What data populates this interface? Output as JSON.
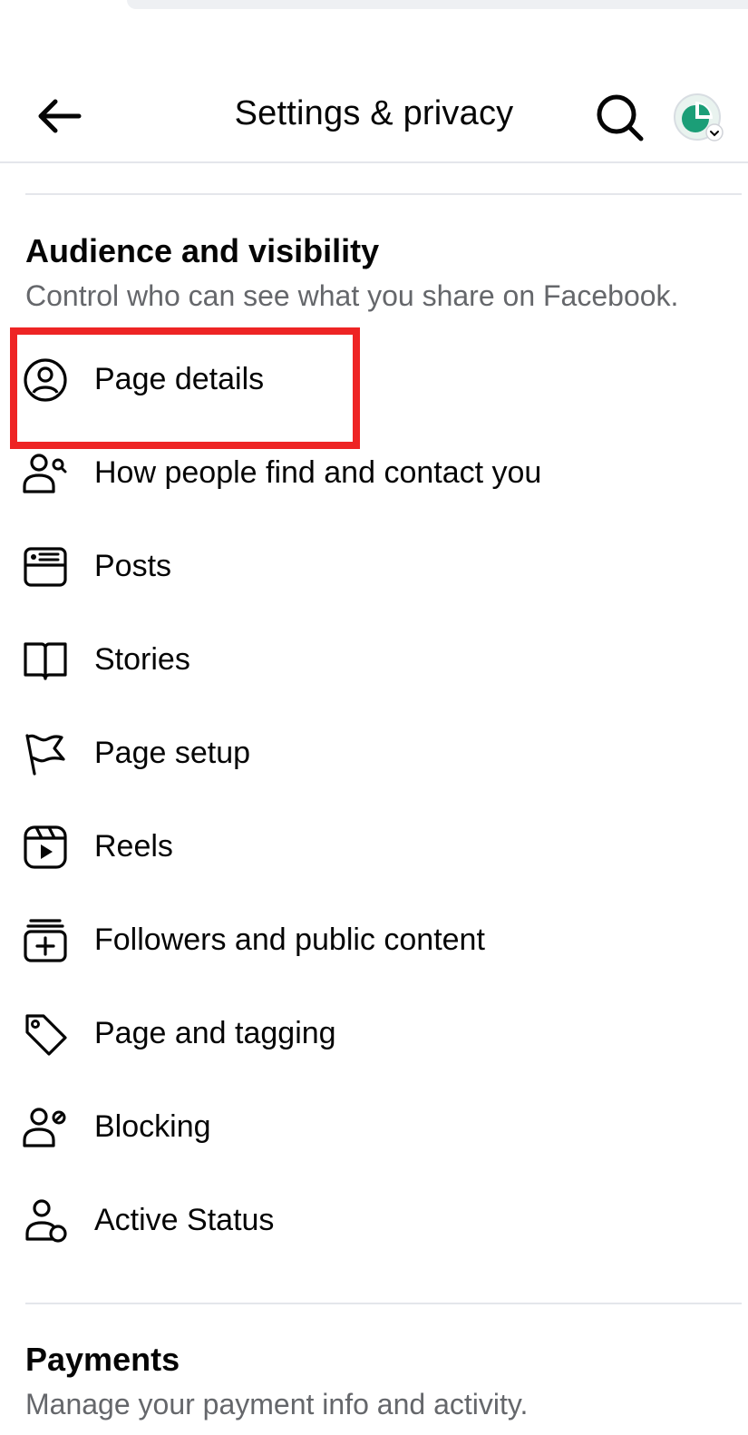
{
  "header": {
    "title": "Settings & privacy",
    "back_icon": "back-arrow-icon",
    "search_icon": "search-icon",
    "avatar_icon": "profile-avatar-icon"
  },
  "audience": {
    "title": "Audience and visibility",
    "subtitle": "Control who can see what you share on Facebook.",
    "items": [
      {
        "label": "Page details",
        "icon": "person-circle-icon",
        "highlighted": true
      },
      {
        "label": "How people find and contact you",
        "icon": "people-search-icon"
      },
      {
        "label": "Posts",
        "icon": "posts-card-icon"
      },
      {
        "label": "Stories",
        "icon": "book-icon"
      },
      {
        "label": "Page setup",
        "icon": "flag-icon"
      },
      {
        "label": "Reels",
        "icon": "reels-play-icon"
      },
      {
        "label": "Followers and public content",
        "icon": "followers-add-icon"
      },
      {
        "label": "Page and tagging",
        "icon": "tag-icon"
      },
      {
        "label": "Blocking",
        "icon": "person-block-icon"
      },
      {
        "label": "Active Status",
        "icon": "person-status-icon"
      }
    ]
  },
  "payments": {
    "title": "Payments",
    "subtitle": "Manage your payment info and activity."
  },
  "colors": {
    "highlight_border": "#ee2424",
    "subtitle_text": "#65676b",
    "divider": "#e4e6eb",
    "avatar_accent": "#1b9e77"
  }
}
